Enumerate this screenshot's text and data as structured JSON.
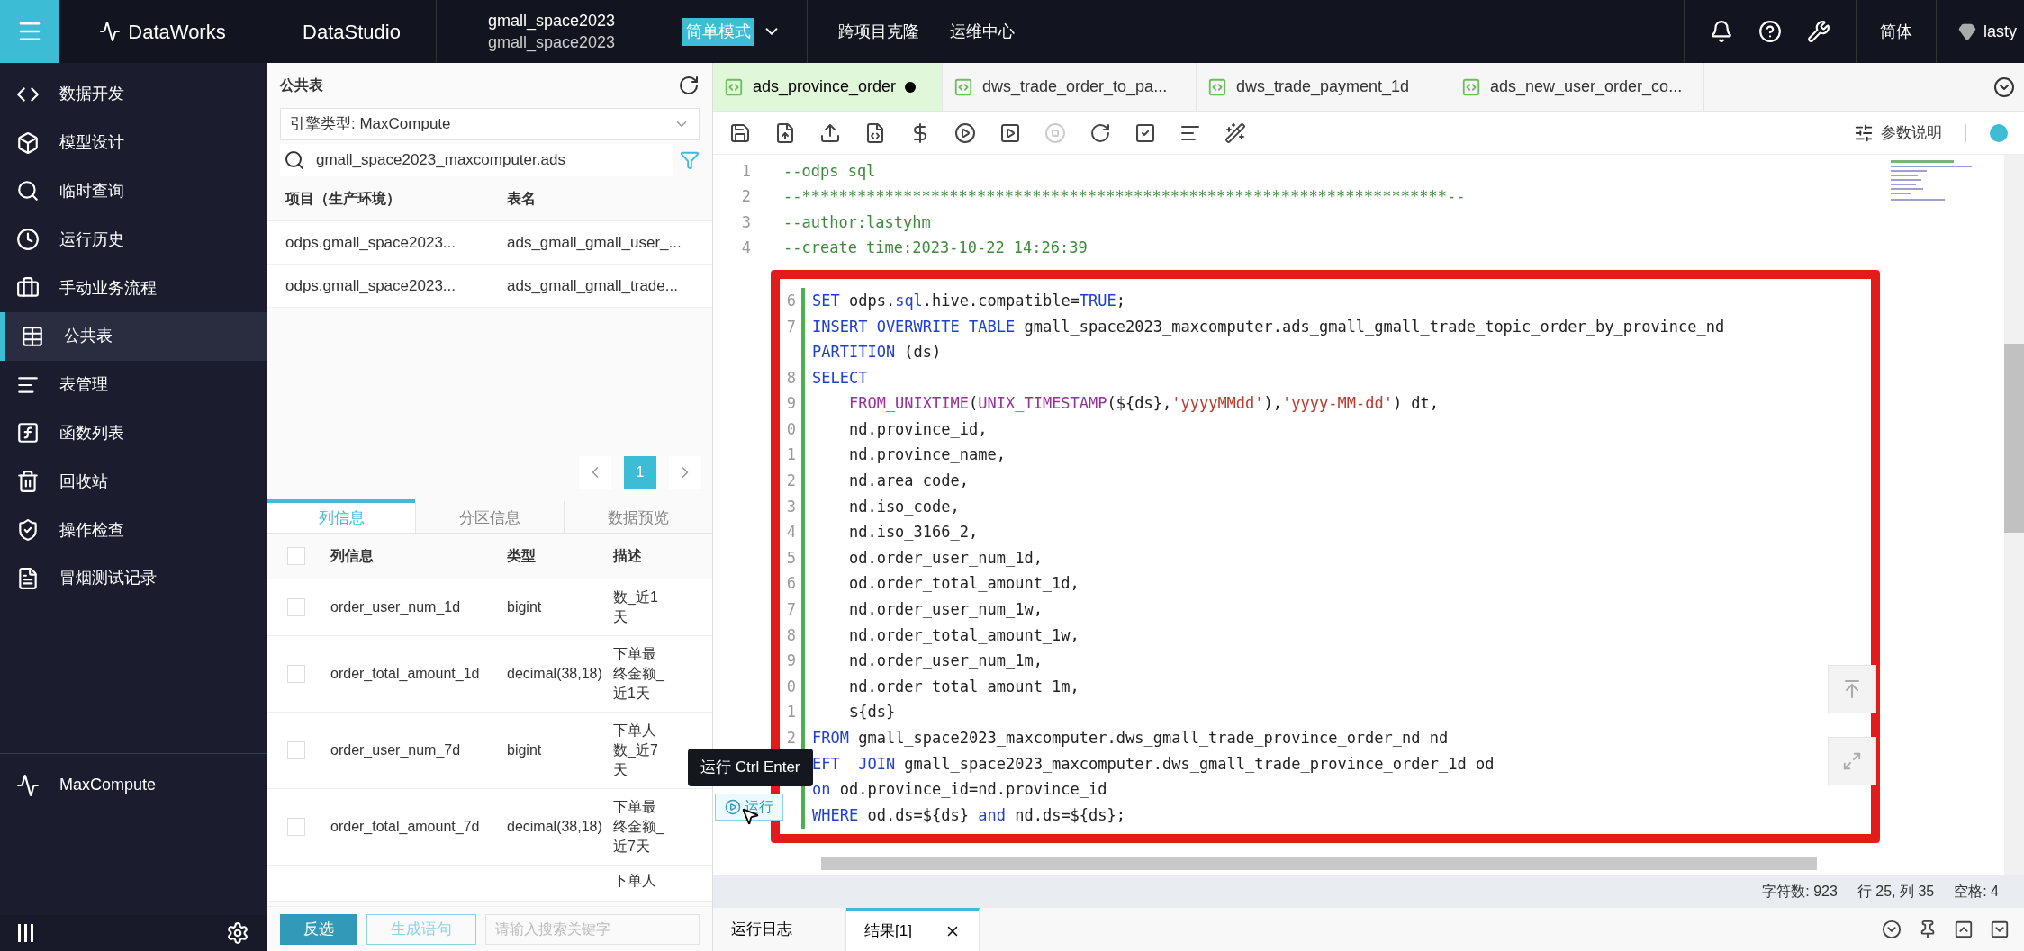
{
  "top_bar": {
    "brand": "DataWorks",
    "module": "DataStudio",
    "workspace": [
      "gmall_space2023",
      "gmall_space2023"
    ],
    "mode": "简单模式",
    "links": [
      "跨项目克隆",
      "运维中心"
    ],
    "language": "简体",
    "user": "lasty"
  },
  "sidebar": {
    "items": [
      {
        "label": "数据开发",
        "selected": false
      },
      {
        "label": "模型设计",
        "selected": false
      },
      {
        "label": "临时查询",
        "selected": false
      },
      {
        "label": "运行历史",
        "selected": false
      },
      {
        "label": "手动业务流程",
        "selected": false
      },
      {
        "label": "公共表",
        "selected": true
      },
      {
        "label": "表管理",
        "selected": false
      },
      {
        "label": "函数列表",
        "selected": false
      },
      {
        "label": "回收站",
        "selected": false
      },
      {
        "label": "操作检查",
        "selected": false
      },
      {
        "label": "冒烟测试记录",
        "selected": false
      }
    ],
    "engine": "MaxCompute"
  },
  "table_panel": {
    "title": "公共表",
    "engine_select": "引擎类型:  MaxCompute",
    "search": "gmall_space2023_maxcomputer.ads",
    "columns": [
      "项目（生产环境）",
      "表名"
    ],
    "rows": [
      [
        "odps.gmall_space2023...",
        "ads_gmall_gmall_user_..."
      ],
      [
        "odps.gmall_space2023...",
        "ads_gmall_gmall_trade..."
      ]
    ],
    "page": "1",
    "tabs": [
      {
        "label": "列信息",
        "selected": true
      },
      {
        "label": "分区信息",
        "selected": false
      },
      {
        "label": "数据预览",
        "selected": false
      }
    ],
    "select_all_checked": false,
    "field_columns": [
      "列信息",
      "类型",
      "描述"
    ],
    "fields": [
      {
        "name": "order_user_num_1d",
        "type": "bigint",
        "desc": "数_近1天",
        "checked": false
      },
      {
        "name": "order_total_amount_1d",
        "type": "decimal(38,18)",
        "desc": "下单最终金额_近1天",
        "checked": false
      },
      {
        "name": "order_user_num_7d",
        "type": "bigint",
        "desc": "下单人数_近7天",
        "checked": false
      },
      {
        "name": "order_total_amount_7d",
        "type": "decimal(38,18)",
        "desc": "下单最终金额_近7天",
        "checked": false
      },
      {
        "desc": "下单人"
      }
    ],
    "buttons": [
      "反选",
      "生成语句"
    ],
    "keyword_placeholder": "请输入搜索关键字"
  },
  "editor": {
    "tabs": [
      {
        "label": "ads_province_order",
        "selected": true,
        "modified": true
      },
      {
        "label": "dws_trade_order_to_pa...",
        "selected": false,
        "modified": false
      },
      {
        "label": "dws_trade_payment_1d",
        "selected": false,
        "modified": false
      },
      {
        "label": "ads_new_user_order_co...",
        "selected": false,
        "modified": false
      }
    ],
    "params_label": "参数说明",
    "lines": [
      {
        "number": "1",
        "tokens": [
          {
            "kind": "comment",
            "text": "--odps sql"
          }
        ]
      },
      {
        "number": "2",
        "tokens": [
          {
            "kind": "comment",
            "text": "--**********************************************************************--"
          }
        ]
      },
      {
        "number": "3",
        "tokens": [
          {
            "kind": "comment",
            "text": "--author:lastyhm"
          }
        ]
      },
      {
        "number": "4",
        "tokens": [
          {
            "kind": "comment",
            "text": "--create time:2023-10-22 14:26:39"
          }
        ]
      }
    ],
    "highlighted_lines": [
      {
        "number": "6",
        "tokens": [
          {
            "kind": "keyword",
            "text": "SET"
          },
          {
            "kind": "plain",
            "text": " odps."
          },
          {
            "kind": "keyword",
            "text": "sql"
          },
          {
            "kind": "plain",
            "text": ".hive.compatible="
          },
          {
            "kind": "keyword",
            "text": "TRUE"
          },
          {
            "kind": "plain",
            "text": ";"
          }
        ]
      },
      {
        "number": "7",
        "tokens": [
          {
            "kind": "keyword",
            "text": "INSERT OVERWRITE TABLE"
          },
          {
            "kind": "plain",
            "text": " gmall_space2023_maxcomputer.ads_gmall_gmall_trade_topic_order_by_province_nd"
          }
        ]
      },
      {
        "tokens": [
          {
            "kind": "keyword",
            "text": "PARTITION"
          },
          {
            "kind": "plain",
            "text": " (ds)"
          }
        ]
      },
      {
        "number": "8",
        "tokens": [
          {
            "kind": "keyword",
            "text": "SELECT"
          }
        ]
      },
      {
        "number": "9",
        "tokens": [
          {
            "kind": "function",
            "text": "    FROM_UNIXTIME"
          },
          {
            "kind": "plain",
            "text": "("
          },
          {
            "kind": "function",
            "text": "UNIX_TIMESTAMP"
          },
          {
            "kind": "plain",
            "text": "(${ds},"
          },
          {
            "kind": "string",
            "text": "'yyyyMMdd'"
          },
          {
            "kind": "plain",
            "text": "),"
          },
          {
            "kind": "string",
            "text": "'yyyy-MM-dd'"
          },
          {
            "kind": "plain",
            "text": ") dt,"
          }
        ]
      },
      {
        "number": "0",
        "tokens": [
          {
            "kind": "plain",
            "text": "    nd.province_id,"
          }
        ]
      },
      {
        "number": "1",
        "tokens": [
          {
            "kind": "plain",
            "text": "    nd.province_name,"
          }
        ]
      },
      {
        "number": "2",
        "tokens": [
          {
            "kind": "plain",
            "text": "    nd.area_code,"
          }
        ]
      },
      {
        "number": "3",
        "tokens": [
          {
            "kind": "plain",
            "text": "    nd.iso_code,"
          }
        ]
      },
      {
        "number": "4",
        "tokens": [
          {
            "kind": "plain",
            "text": "    nd.iso_3166_2,"
          }
        ]
      },
      {
        "number": "5",
        "tokens": [
          {
            "kind": "plain",
            "text": "    od.order_user_num_1d,"
          }
        ]
      },
      {
        "number": "6",
        "tokens": [
          {
            "kind": "plain",
            "text": "    od.order_total_amount_1d,"
          }
        ]
      },
      {
        "number": "7",
        "tokens": [
          {
            "kind": "plain",
            "text": "    nd.order_user_num_1w,"
          }
        ]
      },
      {
        "number": "8",
        "tokens": [
          {
            "kind": "plain",
            "text": "    nd.order_total_amount_1w,"
          }
        ]
      },
      {
        "number": "9",
        "tokens": [
          {
            "kind": "plain",
            "text": "    nd.order_user_num_1m,"
          }
        ]
      },
      {
        "number": "0",
        "tokens": [
          {
            "kind": "plain",
            "text": "    nd.order_total_amount_1m,"
          }
        ]
      },
      {
        "number": "1",
        "tokens": [
          {
            "kind": "plain",
            "text": "    ${ds}"
          }
        ]
      },
      {
        "number": "2",
        "tokens": [
          {
            "kind": "keyword",
            "text": "FROM"
          },
          {
            "kind": "plain",
            "text": " gmall_space2023_maxcomputer.dws_gmall_trade_province_order_nd nd"
          }
        ]
      },
      {
        "tokens": [
          {
            "kind": "keyword",
            "text": "EFT  JOIN"
          },
          {
            "kind": "plain",
            "text": " gmall_space2023_maxcomputer.dws_gmall_trade_province_order_1d od"
          }
        ]
      },
      {
        "tokens": [
          {
            "kind": "keyword",
            "text": "on"
          },
          {
            "kind": "plain",
            "text": " od.province_id=nd.province_id"
          }
        ]
      },
      {
        "tokens": [
          {
            "kind": "keyword",
            "text": "WHERE"
          },
          {
            "kind": "plain",
            "text": " od.ds=${ds} "
          },
          {
            "kind": "keyword",
            "text": "and"
          },
          {
            "kind": "plain",
            "text": " nd.ds=${ds};"
          }
        ]
      }
    ],
    "tooltip": "运行 Ctrl Enter",
    "run_button": "运行",
    "status": [
      "字符数: 923",
      "行 25, 列 35",
      "空格: 4"
    ],
    "bottom_tabs": [
      {
        "label": "运行日志",
        "selected": false,
        "closable": false
      },
      {
        "label": "结果[1]",
        "selected": true,
        "closable": true
      }
    ]
  }
}
